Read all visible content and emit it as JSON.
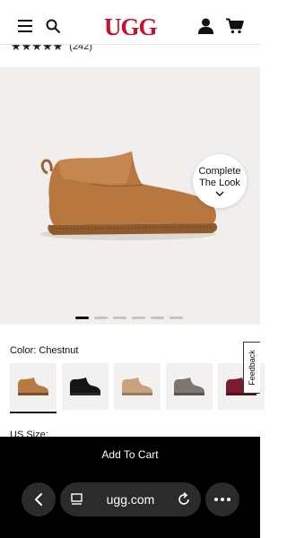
{
  "header": {
    "logo": "UGG",
    "icons": [
      "menu-icon",
      "search-icon",
      "account-icon",
      "cart-icon"
    ]
  },
  "rating": {
    "stars": "★★★★★",
    "count": "(242)"
  },
  "hero": {
    "complete_the_look": "Complete The Look",
    "active_slide": 1,
    "slide_count": 6
  },
  "color": {
    "label": "Color: Chestnut",
    "swatches": [
      "Chestnut",
      "Black",
      "Sand",
      "Charcoal",
      "Burgundy"
    ],
    "swatch_colors": [
      "#b87a44",
      "#151515",
      "#c9a27f",
      "#7d7670",
      "#7a1b30"
    ]
  },
  "feedback": "Feedback",
  "size": {
    "label": "US Size:"
  },
  "cart": {
    "add_label": "Add To Cart"
  },
  "browser": {
    "url": "ugg.com"
  },
  "colors": {
    "brand_red": "#c8102e",
    "hero_background": "#f1efed",
    "bottom_bar": "#000000"
  }
}
